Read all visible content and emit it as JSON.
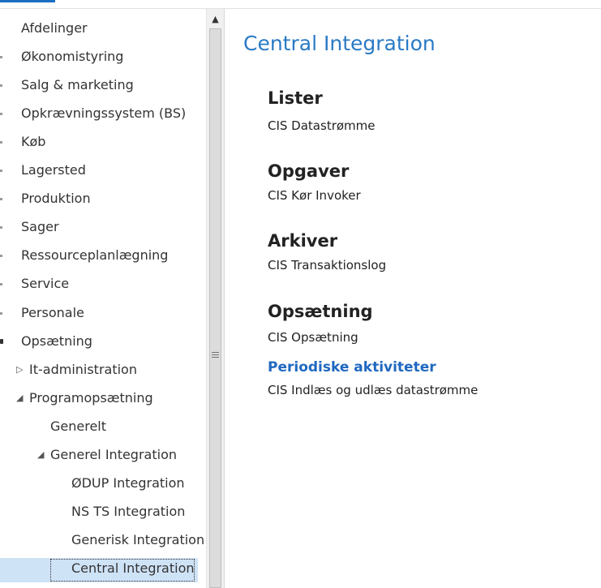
{
  "nav": {
    "items": [
      {
        "label": "Afdelinger",
        "indent": 0,
        "marker": "none"
      },
      {
        "label": "Økonomistyring",
        "indent": 0,
        "marker": "dot"
      },
      {
        "label": "Salg & marketing",
        "indent": 0,
        "marker": "dot"
      },
      {
        "label": "Opkrævningssystem (BS)",
        "indent": 0,
        "marker": "dot"
      },
      {
        "label": "Køb",
        "indent": 0,
        "marker": "dot"
      },
      {
        "label": "Lagersted",
        "indent": 0,
        "marker": "dot"
      },
      {
        "label": "Produktion",
        "indent": 0,
        "marker": "dot"
      },
      {
        "label": "Sager",
        "indent": 0,
        "marker": "dot"
      },
      {
        "label": "Ressourceplanlægning",
        "indent": 0,
        "marker": "dot"
      },
      {
        "label": "Service",
        "indent": 0,
        "marker": "dot"
      },
      {
        "label": "Personale",
        "indent": 0,
        "marker": "dot"
      },
      {
        "label": "Opsætning",
        "indent": 0,
        "marker": "strong"
      },
      {
        "label": "It-administration",
        "indent": 1,
        "marker": "collapsed"
      },
      {
        "label": "Programopsætning",
        "indent": 1,
        "marker": "expanded"
      },
      {
        "label": "Generelt",
        "indent": 2,
        "marker": "none"
      },
      {
        "label": "Generel Integration",
        "indent": 2,
        "marker": "expanded"
      },
      {
        "label": "ØDUP Integration",
        "indent": 3,
        "marker": "none"
      },
      {
        "label": "NS TS Integration",
        "indent": 3,
        "marker": "none"
      },
      {
        "label": "Generisk Integration",
        "indent": 3,
        "marker": "none"
      },
      {
        "label": "Central Integration",
        "indent": 3,
        "marker": "none",
        "selected": true
      }
    ]
  },
  "main": {
    "title": "Central Integration",
    "sections": [
      {
        "heading": "Lister",
        "style": "black",
        "links": [
          "CIS Datastrømme"
        ]
      },
      {
        "heading": "Opgaver",
        "style": "black",
        "links": [
          "CIS Kør Invoker"
        ]
      },
      {
        "heading": "Arkiver",
        "style": "black",
        "links": [
          "CIS Transaktionslog"
        ]
      },
      {
        "heading": "Opsætning",
        "style": "black",
        "links": [
          "CIS Opsætning"
        ]
      },
      {
        "heading": "Periodiske aktiviteter",
        "style": "blue",
        "links": [
          "CIS Indlæs og udlæs datastrømme"
        ]
      }
    ]
  },
  "colors": {
    "accent": "#2a7ac5",
    "selection": "#cfe3f7"
  },
  "icons": {
    "collapsed": "triangle-right-icon",
    "expanded": "triangle-down-icon",
    "scroll_up": "scroll-up-arrow-icon",
    "grip": "scroll-grip-icon"
  }
}
